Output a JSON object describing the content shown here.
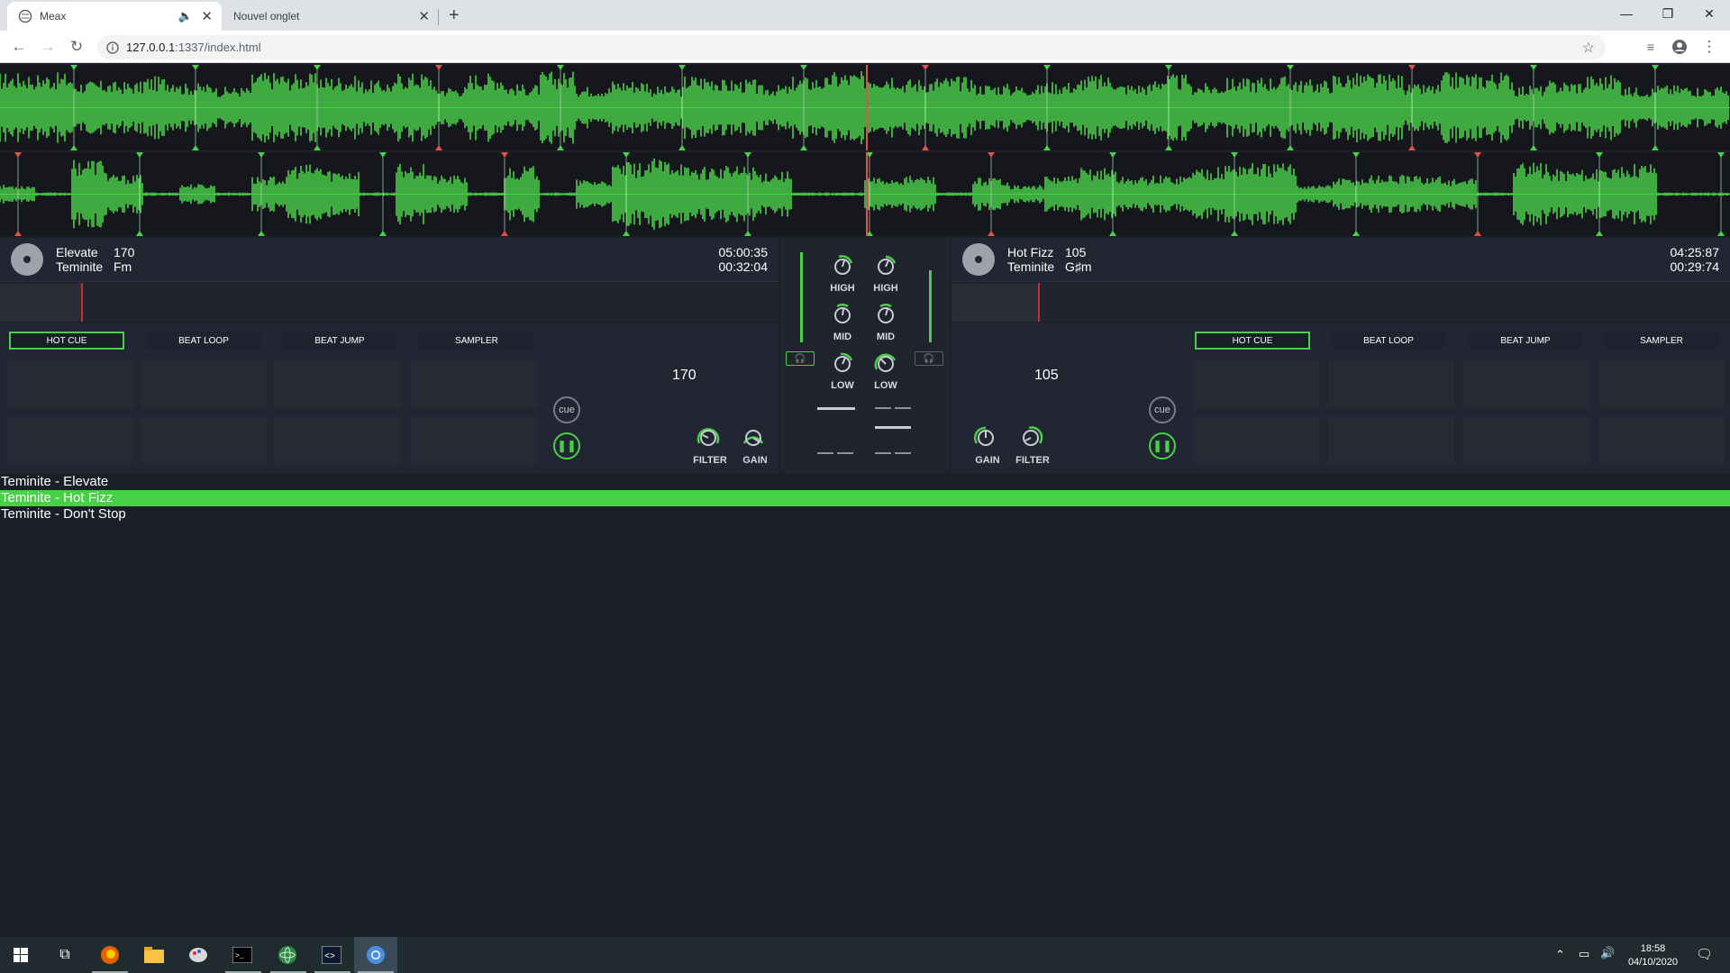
{
  "browser": {
    "tabs": [
      {
        "title": "Meax",
        "active": true
      },
      {
        "title": "Nouvel onglet",
        "active": false
      }
    ],
    "url_host": "127.0.0.1",
    "url_path": ":1337/index.html",
    "icons": {
      "back": "arrow-left",
      "forward": "arrow-right",
      "reload": "reload",
      "info": "info",
      "star": "star",
      "media": "media-control",
      "profile": "profile",
      "menu": "kebab-menu",
      "minimize": "minimize",
      "maximize": "maximize",
      "close": "close"
    }
  },
  "colors": {
    "accent": "#48d048",
    "background": "#1b1f28",
    "panel": "#222633",
    "marker": "#e0504c"
  },
  "deck_a": {
    "title": "Elevate",
    "bpm": "170",
    "artist": "Teminite",
    "key": "Fm",
    "time_total": "05:00:35",
    "time_elapsed": "00:32:04",
    "tabs": [
      "HOT CUE",
      "BEAT LOOP",
      "BEAT JUMP",
      "SAMPLER"
    ],
    "selected_tab": "HOT CUE",
    "cue_label": "cue",
    "bpm_display": "170",
    "knob_labels": [
      "FILTER",
      "GAIN"
    ]
  },
  "deck_b": {
    "title": "Hot Fizz",
    "bpm": "105",
    "artist": "Teminite",
    "key": "G♯m",
    "time_total": "04:25:87",
    "time_elapsed": "00:29:74",
    "tabs": [
      "HOT CUE",
      "BEAT LOOP",
      "BEAT JUMP",
      "SAMPLER"
    ],
    "selected_tab": "HOT CUE",
    "cue_label": "cue",
    "bpm_display": "105",
    "knob_labels": [
      "GAIN",
      "FILTER"
    ]
  },
  "mixer": {
    "eq_labels": [
      "HIGH",
      "HIGH",
      "MID",
      "MID",
      "LOW",
      "LOW"
    ],
    "headphone_icon": "headphones-icon"
  },
  "playlist": [
    {
      "label": "Teminite - Elevate",
      "selected": false
    },
    {
      "label": "Teminite - Hot Fizz",
      "selected": true
    },
    {
      "label": "Teminite - Don't Stop",
      "selected": false
    }
  ],
  "taskbar": {
    "time": "18:58",
    "date": "04/10/2020",
    "apps": [
      "windows-start",
      "task-view",
      "firefox",
      "file-explorer",
      "paint",
      "terminal",
      "atom-editor",
      "code-editor",
      "chrome"
    ]
  }
}
